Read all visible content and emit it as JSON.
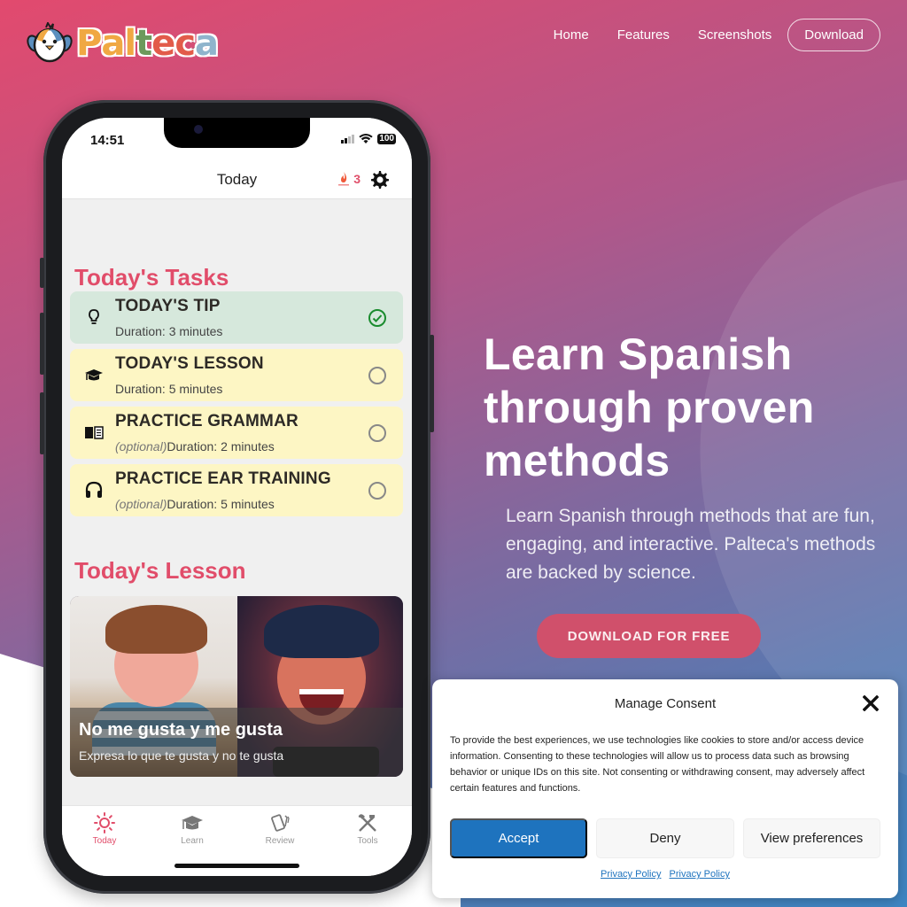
{
  "brand": {
    "name": "Palteca",
    "letters": [
      {
        "ch": "P",
        "color": "#f0a843"
      },
      {
        "ch": "a",
        "color": "#f0a843"
      },
      {
        "ch": "l",
        "color": "#f0a843"
      },
      {
        "ch": "t",
        "color": "#6c9a5c"
      },
      {
        "ch": "e",
        "color": "#e25b4a"
      },
      {
        "ch": "c",
        "color": "#e25b4a"
      },
      {
        "ch": "a",
        "color": "#8fb4cc"
      }
    ]
  },
  "nav": {
    "items": [
      "Home",
      "Features",
      "Screenshots"
    ],
    "download_label": "Download"
  },
  "phone": {
    "status": {
      "time": "14:51",
      "battery": "100"
    },
    "header": {
      "title": "Today",
      "streak_count": "3"
    },
    "tasks_title": "Today's Tasks",
    "tasks": [
      {
        "icon": "lightbulb-icon",
        "title": "TODAY'S TIP",
        "optional": "",
        "duration": "Duration: 3 minutes",
        "done": true
      },
      {
        "icon": "graduation-cap-icon",
        "title": "TODAY'S LESSON",
        "optional": "",
        "duration": "Duration: 5 minutes",
        "done": false
      },
      {
        "icon": "book-icon",
        "title": "PRACTICE GRAMMAR",
        "optional": "(optional)",
        "duration": "Duration: 2 minutes",
        "done": false
      },
      {
        "icon": "headphones-icon",
        "title": "PRACTICE EAR TRAINING",
        "optional": "(optional)",
        "duration": "Duration: 5 minutes",
        "done": false
      }
    ],
    "lesson_title": "Today's Lesson",
    "lesson": {
      "title": "No me gusta y me gusta",
      "subtitle": "Expresa lo que te gusta y no te gusta"
    },
    "tabs": [
      {
        "label": "Today",
        "active": true
      },
      {
        "label": "Learn",
        "active": false
      },
      {
        "label": "Review",
        "active": false
      },
      {
        "label": "Tools",
        "active": false
      }
    ]
  },
  "hero": {
    "title_lines": [
      "Learn Spanish",
      "through proven",
      "methods"
    ],
    "subtitle": "Learn Spanish through methods that are fun, engaging, and interactive. Palteca's methods are backed by science.",
    "cta_label": "DOWNLOAD FOR FREE"
  },
  "consent": {
    "title": "Manage Consent",
    "body": "To provide the best experiences, we use technologies like cookies to store and/or access device information. Consenting to these technologies will allow us to process data such as browsing behavior or unique IDs on this site. Not consenting or withdrawing consent, may adversely affect certain features and functions.",
    "accept_label": "Accept",
    "deny_label": "Deny",
    "preferences_label": "View preferences",
    "links": [
      "Privacy Policy",
      "Privacy Policy"
    ]
  },
  "colors": {
    "accent_pink": "#e14d6a",
    "cta_pink": "#d0506b",
    "accept_blue": "#1e73be",
    "task_done_bg": "#d6e8dc",
    "task_todo_bg": "#fdf6c4",
    "check_green": "#1a8c2e"
  }
}
